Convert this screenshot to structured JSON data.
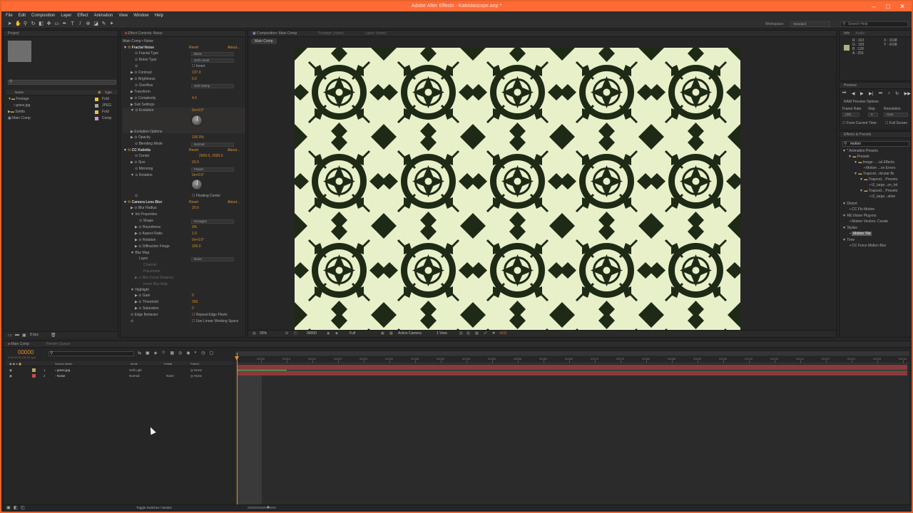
{
  "window": {
    "title": "Adobe After Effects - Kaleidascope.aep *"
  },
  "menu": [
    "File",
    "Edit",
    "Composition",
    "Layer",
    "Effect",
    "Animation",
    "View",
    "Window",
    "Help"
  ],
  "workspace": {
    "label": "Workspace:",
    "value": "Standard",
    "search_placeholder": "Search Help"
  },
  "project_panel": {
    "tab": "Project",
    "search_placeholder": "",
    "columns": {
      "name": "Name",
      "type": "Type"
    },
    "items": [
      {
        "name": "Footage",
        "type": "Fold"
      },
      {
        "name": "grass.jpg",
        "type": "JPEG"
      },
      {
        "name": "Solids",
        "type": "Fold"
      },
      {
        "name": "Main Comp",
        "type": "Comp"
      }
    ],
    "bpc": "8 bpc"
  },
  "effect_controls": {
    "tab": "Effect Controls: Noise",
    "breadcrumb": "Main Comp • Noise",
    "effects": [
      {
        "name": "Fractal Noise",
        "reset": "Reset",
        "about": "About..."
      },
      {
        "name": "CC Kaleida",
        "reset": "Reset",
        "about": "About..."
      },
      {
        "name": "Camera Lens Blur",
        "reset": "Reset",
        "about": "About..."
      }
    ],
    "props": {
      "fractal_type": {
        "label": "Fractal Type",
        "value": "Basic"
      },
      "noise_type": {
        "label": "Noise Type",
        "value": "Soft Linear"
      },
      "invert": "Invert",
      "contrast": {
        "label": "Contrast",
        "value": "137.0"
      },
      "brightness": {
        "label": "Brightness",
        "value": "0.0"
      },
      "overflow": {
        "label": "Overflow",
        "value": "Soft Clamp"
      },
      "transform": "Transform",
      "complexity": {
        "label": "Complexity",
        "value": "4.0"
      },
      "sub_settings": "Sub Settings",
      "evolution": {
        "label": "Evolution",
        "value": "0x+0.0°"
      },
      "evolution_options": "Evolution Options",
      "opacity": {
        "label": "Opacity",
        "value": "100.0%"
      },
      "blending_mode": {
        "label": "Blending Mode",
        "value": "Normal"
      },
      "center": {
        "label": "Center",
        "value": "2500.0, 2500.0"
      },
      "size": {
        "label": "Size",
        "value": "20.0"
      },
      "mirroring": {
        "label": "Mirroring",
        "value": "Flower"
      },
      "rotation": {
        "label": "Rotation",
        "value": "0x+0.0°"
      },
      "floating_center": "Floating Center",
      "blur_radius": {
        "label": "Blur Radius",
        "value": "20.0"
      },
      "iris_properties": "Iris Properties",
      "shape": {
        "label": "Shape",
        "value": "Hexagon"
      },
      "roundness": {
        "label": "Roundness",
        "value": "0%"
      },
      "aspect_ratio": {
        "label": "Aspect Ratio",
        "value": "1.0"
      },
      "iris_rotation": {
        "label": "Rotation",
        "value": "0x+0.0°"
      },
      "diffraction_fringe": {
        "label": "Diffraction Fringe",
        "value": "100.0"
      },
      "blur_map": "Blur Map",
      "layer": {
        "label": "Layer",
        "value": "None"
      },
      "channel": "Channel",
      "placement": "Placement",
      "blur_focal_distance": "Blur Focal Distance",
      "invert_blur_map": "Invert Blur Map",
      "highlight": "Highlight",
      "gain": {
        "label": "Gain",
        "value": "0"
      },
      "threshold": {
        "label": "Threshold",
        "value": "255"
      },
      "saturation": {
        "label": "Saturation",
        "value": "0"
      },
      "edge_behavior": {
        "label": "Edge Behavior",
        "value": "Repeat Edge Pixels"
      },
      "linear_working_space": "Use Linear Working Space"
    }
  },
  "composition": {
    "tab": "Composition: Main Comp",
    "footage_tab": "Footage: (none)",
    "layer_tab": "Layer: (none)",
    "sub_tab": "Main Comp",
    "zoom": "25%",
    "timecode": "00000",
    "resolution": "Full",
    "camera": "Active Camera",
    "view": "1 View",
    "offset": "+0.0"
  },
  "info_panel": {
    "tab": "Info",
    "audio_tab": "Audio",
    "r": "R : 163",
    "g": "G : 183",
    "b": "B : 128",
    "a": "A : 255",
    "x": "X : 1538",
    "y": "Y : 4108"
  },
  "preview_panel": {
    "tab": "Preview",
    "ram_options": "RAM Preview Options",
    "frame_rate_label": "Frame Rate",
    "skip_label": "Skip",
    "resolution_label": "Resolution",
    "frame_rate": "(30)",
    "skip": "0",
    "resolution": "Auto",
    "from_current": "From Current Time",
    "full_screen": "Full Screen"
  },
  "effects_presets": {
    "tab": "Effects & Presets",
    "search_value": "motion",
    "tree": [
      "* Animation Presets",
      "Presets",
      "Image - ...ial Effects",
      "Motion ...on Errors",
      "Trapcod...rticular ffx",
      "Trapcod... Presets",
      "t2_large...on_hd",
      "Trapcod... Presets",
      "t2_large...ation",
      "Distort",
      "CC Flo Motion",
      "RE:Vision Plug-ins",
      "Motion Vectors: Create",
      "Stylize",
      "Motion Tile",
      "Time",
      "CC Force Motion Blur"
    ]
  },
  "timeline": {
    "tab": "Main Comp",
    "render_queue_tab": "Render Queue",
    "timecode": "00000",
    "subtime": "0:00:00:00 (30.00 fps)",
    "columns": {
      "source": "Source Name",
      "mode": "Mode",
      "trkmat": "TrkMat",
      "parent": "Parent"
    },
    "layers": [
      {
        "num": "1",
        "name": "grass.jpg",
        "mode": "Soft Ligh",
        "trkmat": "",
        "parent": "None"
      },
      {
        "num": "2",
        "name": "Noise",
        "mode": "Normal",
        "trkmat": "None",
        "parent": "None"
      }
    ],
    "ruler": [
      "00005",
      "00010",
      "00015",
      "00020",
      "00025",
      "00030",
      "00035",
      "00040",
      "00045",
      "00050",
      "00055",
      "00060",
      "00065",
      "00070",
      "00075",
      "00080",
      "00085",
      "00090",
      "00095",
      "00100",
      "00105",
      "00110",
      "00115",
      "00120",
      "00125",
      "00130"
    ],
    "toggle_label": "Toggle Switches / Modes"
  },
  "colors": {
    "title_bar": "#ff6a35",
    "accent_orange": "#e0902e",
    "layer_bar": "#8a3a3e",
    "pattern_light": "#e7f0c9",
    "pattern_dark": "#1f2a16"
  }
}
